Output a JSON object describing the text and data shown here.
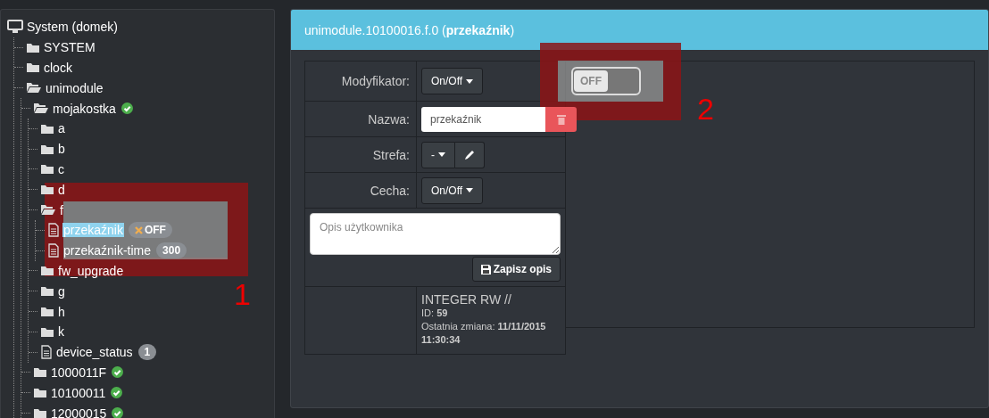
{
  "tree": {
    "label": "System (domek)",
    "kind": "monitor",
    "selected": false,
    "children": [
      {
        "label": "SYSTEM",
        "kind": "folder",
        "selected": false
      },
      {
        "label": "clock",
        "kind": "folder",
        "selected": false
      },
      {
        "label": "unimodule",
        "kind": "folder-open",
        "selected": false,
        "children": [
          {
            "label": "mojakostka",
            "kind": "folder-open",
            "selected": false,
            "badge": {
              "kind": "check"
            },
            "children": [
              {
                "label": "a",
                "kind": "folder",
                "selected": false
              },
              {
                "label": "b",
                "kind": "folder",
                "selected": false
              },
              {
                "label": "c",
                "kind": "folder",
                "selected": false
              },
              {
                "label": "d",
                "kind": "folder",
                "selected": false
              },
              {
                "label": "f",
                "kind": "folder-open",
                "selected": false,
                "children": [
                  {
                    "label": "przekaźnik",
                    "kind": "file",
                    "selected": true,
                    "badge": {
                      "kind": "state",
                      "text": "OFF"
                    }
                  },
                  {
                    "label": "przekaźnik-time",
                    "kind": "file",
                    "selected": false,
                    "badge": {
                      "kind": "count",
                      "text": "300"
                    }
                  }
                ]
              },
              {
                "label": "fw_upgrade",
                "kind": "folder",
                "selected": false
              },
              {
                "label": "g",
                "kind": "folder",
                "selected": false
              },
              {
                "label": "h",
                "kind": "folder",
                "selected": false
              },
              {
                "label": "k",
                "kind": "folder",
                "selected": false
              },
              {
                "label": "device_status",
                "kind": "file",
                "selected": false,
                "badge": {
                  "kind": "count",
                  "text": "1"
                }
              }
            ]
          },
          {
            "label": "1000011F",
            "kind": "folder",
            "selected": false,
            "badge": {
              "kind": "check"
            }
          },
          {
            "label": "10100011",
            "kind": "folder",
            "selected": false,
            "badge": {
              "kind": "check"
            }
          },
          {
            "label": "12000015",
            "kind": "folder",
            "selected": false,
            "badge": {
              "kind": "check"
            }
          }
        ]
      }
    ]
  },
  "panel": {
    "title": "unimodule.10100016.f.0 (**przekaźnik**)",
    "rows": [
      {
        "kind": "dropdown",
        "label": "Modyfikator:",
        "value": "On/Off"
      },
      {
        "kind": "text",
        "label": "Nazwa:",
        "value": "przekaźnik"
      },
      {
        "kind": "dropdown-edit",
        "label": "Strefa:",
        "value": "-"
      },
      {
        "kind": "dropdown",
        "label": "Cecha:",
        "value": "On/Off"
      }
    ],
    "description": {
      "placeholder": "Opis użytkownika"
    },
    "save_button": "Zapisz opis",
    "info": {
      "type": "INTEGER RW //",
      "id": "ID: **59**",
      "changed": "Ostatnia zmiana: **11/11/2015 11:30:34**"
    },
    "toggle": {
      "label": "OFF",
      "on": false
    }
  },
  "annotations": [
    {
      "label": "1"
    },
    {
      "label": "2"
    }
  ]
}
